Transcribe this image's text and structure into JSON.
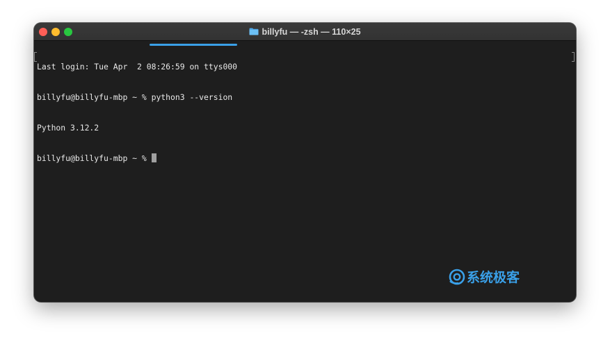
{
  "window": {
    "title": "billyfu — -zsh — 110×25",
    "title_icon": "folder-icon",
    "traffic_lights": [
      "close",
      "minimize",
      "zoom"
    ]
  },
  "terminal": {
    "lines": [
      "Last login: Tue Apr  2 08:26:59 on ttys000",
      "billyfu@billyfu-mbp ~ % python3 --version",
      "Python 3.12.2",
      "billyfu@billyfu-mbp ~ % "
    ],
    "highlighted_command": "python3 --version"
  },
  "watermark": {
    "text": "系统极客",
    "logo": "watermark-logo-icon"
  },
  "colors": {
    "accent": "#3aa0e8",
    "terminal_bg": "#1e1e1e",
    "text": "#e8e8e8",
    "close": "#ff5f57",
    "minimize": "#febc2e",
    "zoom": "#28c840"
  }
}
